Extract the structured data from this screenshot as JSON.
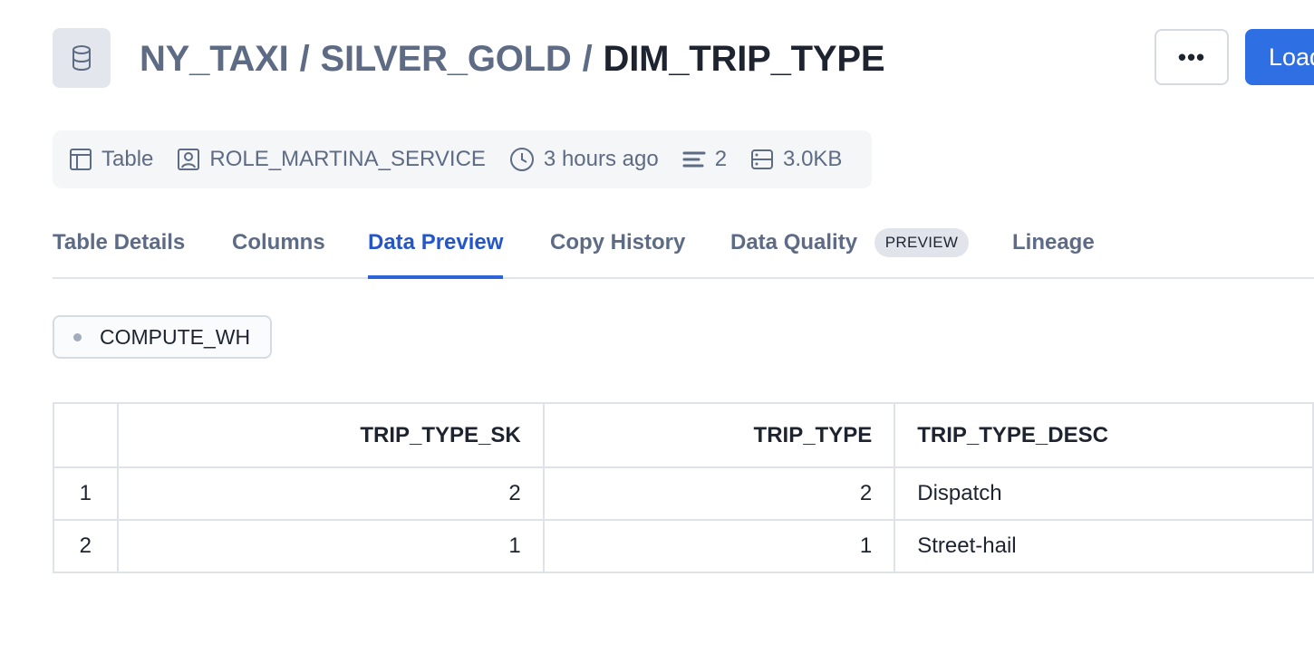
{
  "header": {
    "breadcrumb": {
      "database": "NY_TAXI",
      "separator": "/",
      "schema": "SILVER_GOLD",
      "table": "DIM_TRIP_TYPE"
    },
    "more_label": "•••",
    "load_label": "Load Data"
  },
  "meta": {
    "type": "Table",
    "owner": "ROLE_MARTINA_SERVICE",
    "updated": "3 hours ago",
    "rows": "2",
    "size": "3.0KB"
  },
  "tabs": [
    {
      "label": "Table Details"
    },
    {
      "label": "Columns"
    },
    {
      "label": "Data Preview",
      "active": true
    },
    {
      "label": "Copy History"
    },
    {
      "label": "Data Quality",
      "badge": "PREVIEW"
    },
    {
      "label": "Lineage"
    }
  ],
  "warehouse": {
    "name": "COMPUTE_WH"
  },
  "table": {
    "columns": [
      "",
      "TRIP_TYPE_SK",
      "TRIP_TYPE",
      "TRIP_TYPE_DESC"
    ],
    "rows": [
      [
        "1",
        "2",
        "2",
        "Dispatch"
      ],
      [
        "2",
        "1",
        "1",
        "Street-hail"
      ]
    ]
  },
  "colors": {
    "accent": "#2f6fe4",
    "active_tab": "#2456c9",
    "muted_text": "#5d6b85"
  }
}
